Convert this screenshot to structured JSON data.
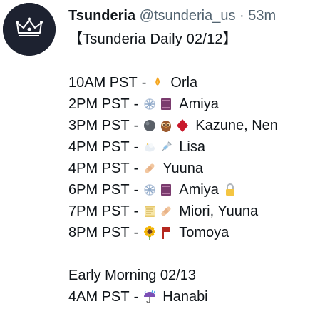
{
  "header": {
    "display_name": "Tsunderia",
    "handle": "@tsunderia_us",
    "separator": "·",
    "time": "53m"
  },
  "title": "【Tsunderia Daily 02/12】",
  "schedule": [
    {
      "time": "10AM PST",
      "sep": "-",
      "icons": [
        "candle-flame-icon"
      ],
      "names": "Orla"
    },
    {
      "time": "2PM PST",
      "sep": "-",
      "icons": [
        "snowflake-icon",
        "book-icon"
      ],
      "names": "Amiya"
    },
    {
      "time": "3PM PST",
      "sep": "-",
      "icons": [
        "dark-orb-icon",
        "owl-icon",
        "red-diamond-icon"
      ],
      "names": "Kazune, Nen"
    },
    {
      "time": "4PM PST",
      "sep": "-",
      "icons": [
        "cloud-icon",
        "syringe-icon"
      ],
      "names": "Lisa"
    },
    {
      "time": "4PM PST",
      "sep": "-",
      "icons": [
        "bandage-icon"
      ],
      "names": "Yuuna"
    },
    {
      "time": "6PM PST",
      "sep": "-",
      "icons": [
        "snowflake-icon",
        "book-icon"
      ],
      "names": "Amiya",
      "trailing_icon": "lock-icon"
    },
    {
      "time": "7PM PST",
      "sep": "-",
      "icons": [
        "scroll-icon",
        "bandage-icon"
      ],
      "names": "Miori, Yuuna"
    },
    {
      "time": "8PM PST",
      "sep": "-",
      "icons": [
        "sunflower-icon",
        "red-flag-icon"
      ],
      "names": "Tomoya"
    }
  ],
  "section2": {
    "heading": "Early Morning 02/13",
    "rows": [
      {
        "time": "4AM PST",
        "sep": "-",
        "icons": [
          "umbrella-rain-icon"
        ],
        "names": "Hanabi"
      }
    ]
  },
  "colors": {
    "text": "#0f1419",
    "muted": "#536471",
    "avatar_bg": "#1d2230"
  }
}
